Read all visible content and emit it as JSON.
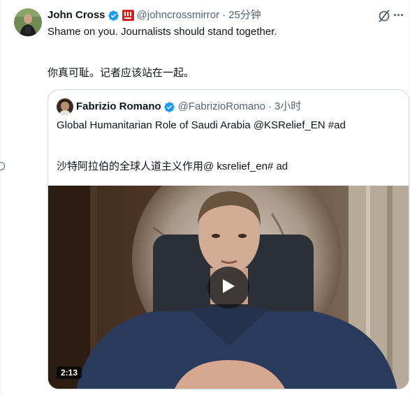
{
  "tweet": {
    "author_name": "John Cross",
    "author_handle": "@johncrossmirror",
    "time": "25分钟",
    "separator": "·",
    "text_line1": "Shame on you. Journalists should stand together.",
    "text_line2": "你真可耻。记者应该站在一起。",
    "verified_icon": "verified-badge-icon",
    "affiliation_icon": "mirror-affiliation-badge",
    "grok_icon": "grok-icon",
    "more_icon": "more-options-icon"
  },
  "quoted": {
    "author_name": "Fabrizio Romano",
    "author_handle": "@FabrizioRomano",
    "time": "3小时",
    "separator": "·",
    "text_line1": "Global Humanitarian Role of Saudi Arabia @KSRelief_EN #ad",
    "text_line2": "沙特阿拉伯的全球人道主义作用@ ksrelief_en# ad",
    "video_duration": "2:13",
    "play_icon": "play-icon"
  },
  "colors": {
    "primary_text": "#0f1419",
    "secondary_text": "#536471",
    "verified_blue": "#1d9bf0",
    "border": "#cfd9de",
    "affiliation_red": "#d6201f"
  }
}
